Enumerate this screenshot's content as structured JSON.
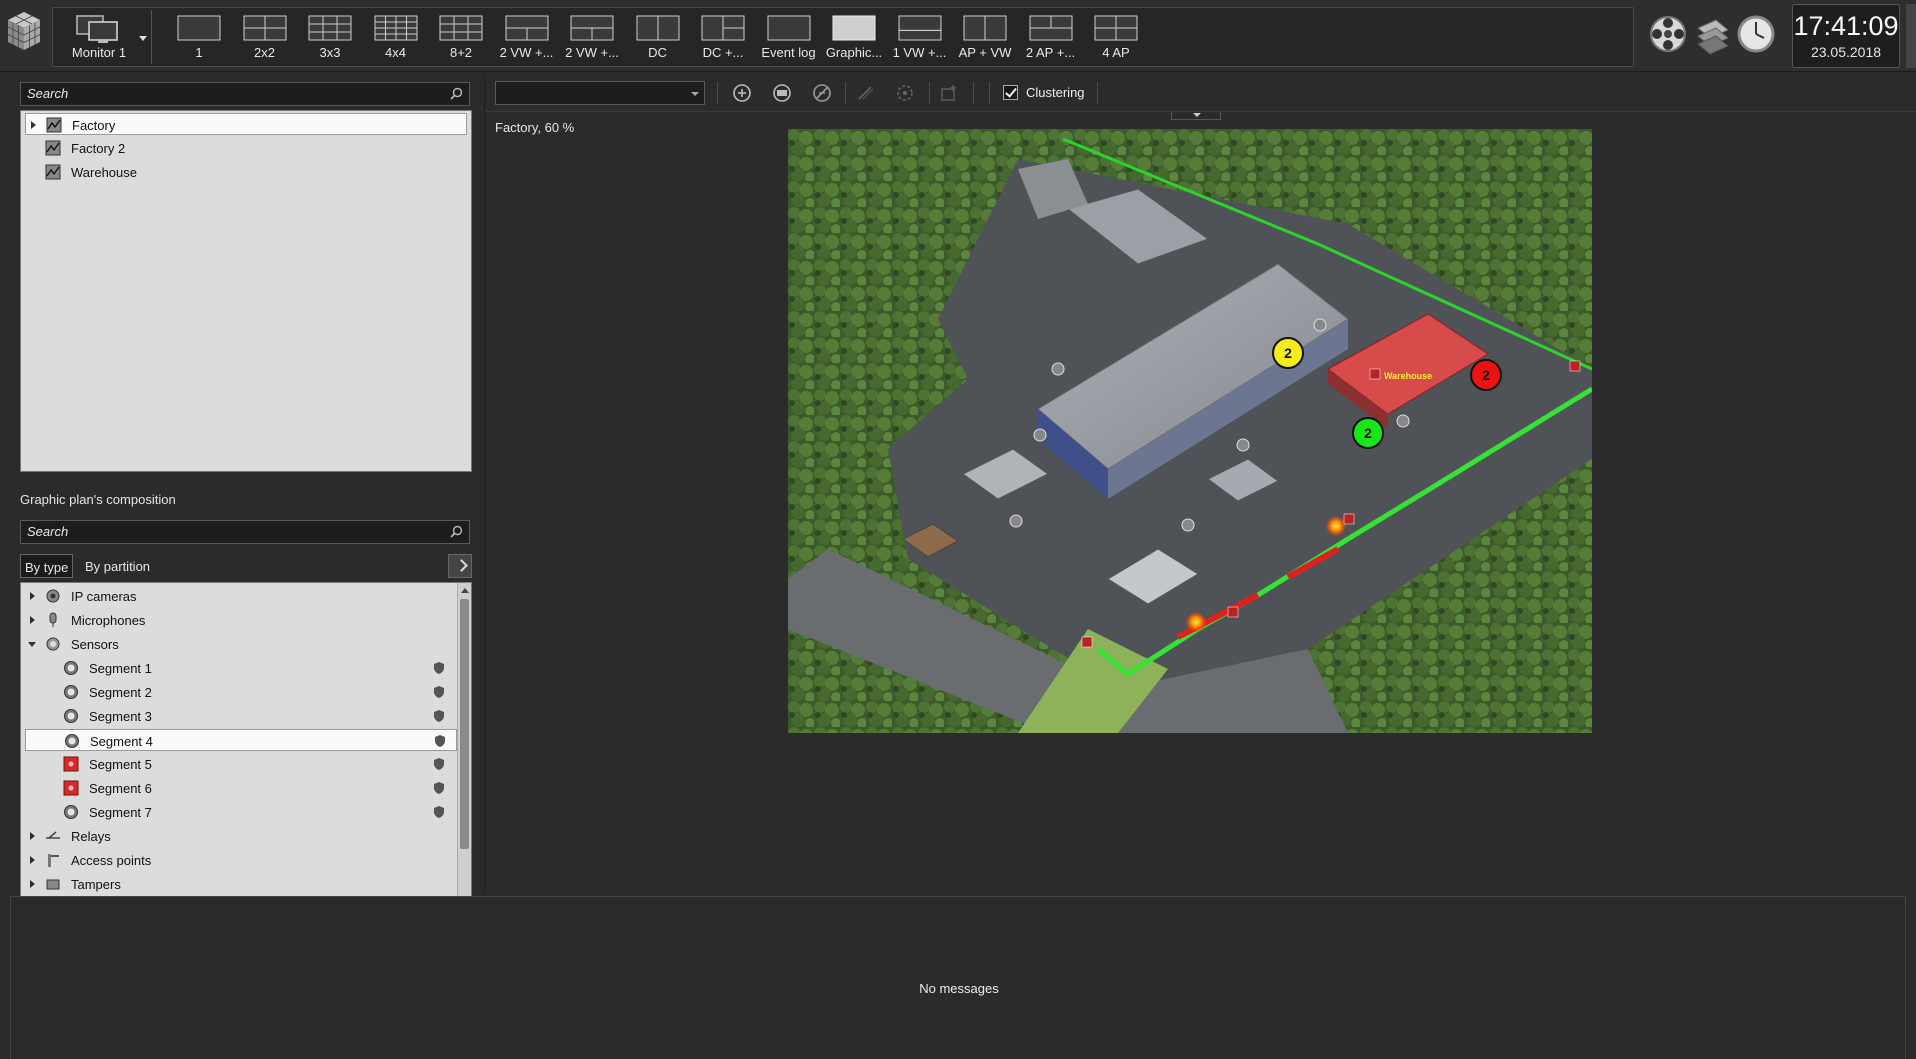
{
  "monitor": {
    "label": "Monitor 1"
  },
  "layouts": [
    {
      "label": "1",
      "icon": "layout-1-icon"
    },
    {
      "label": "2x2",
      "icon": "layout-2x2-icon"
    },
    {
      "label": "3x3",
      "icon": "layout-3x3-icon"
    },
    {
      "label": "4x4",
      "icon": "layout-4x4-icon"
    },
    {
      "label": "8+2",
      "icon": "layout-8plus2-icon"
    },
    {
      "label": "2 VW +...",
      "icon": "layout-2vw-icon"
    },
    {
      "label": "2 VW +...",
      "icon": "layout-2vw-icon"
    },
    {
      "label": "DC",
      "icon": "layout-dc-icon"
    },
    {
      "label": "DC +...",
      "icon": "layout-dc-plus-icon"
    },
    {
      "label": "Event log",
      "icon": "layout-eventlog-icon"
    },
    {
      "label": "Graphic...",
      "icon": "layout-graphic-icon"
    },
    {
      "label": "1 VW +...",
      "icon": "layout-1vw-icon"
    },
    {
      "label": "AP + VW",
      "icon": "layout-ap-vw-icon"
    },
    {
      "label": "2 AP +...",
      "icon": "layout-2ap-icon"
    },
    {
      "label": "4 AP",
      "icon": "layout-4ap-icon"
    }
  ],
  "clock": {
    "time": "17:41:09",
    "date": "23.05.2018"
  },
  "plans_search": {
    "placeholder": "Search"
  },
  "plans": [
    {
      "label": "Factory",
      "selected": true
    },
    {
      "label": "Factory 2",
      "selected": false
    },
    {
      "label": "Warehouse",
      "selected": false
    }
  ],
  "composition": {
    "title": "Graphic plan's composition",
    "search_placeholder": "Search",
    "tabs": [
      "By type",
      "By partition"
    ],
    "items": [
      {
        "label": "IP cameras",
        "level": 0,
        "expand": "collapsed",
        "icon": "ip-camera-icon"
      },
      {
        "label": "Microphones",
        "level": 0,
        "expand": "collapsed",
        "icon": "microphone-icon"
      },
      {
        "label": "Sensors",
        "level": 0,
        "expand": "expanded",
        "icon": "sensor-icon"
      },
      {
        "label": "Segment 1",
        "level": 1,
        "status": "normal"
      },
      {
        "label": "Segment 2",
        "level": 1,
        "status": "normal"
      },
      {
        "label": "Segment 3",
        "level": 1,
        "status": "normal"
      },
      {
        "label": "Segment 4",
        "level": 1,
        "status": "normal",
        "selected": true
      },
      {
        "label": "Segment 5",
        "level": 1,
        "status": "alarm"
      },
      {
        "label": "Segment 6",
        "level": 1,
        "status": "alarm"
      },
      {
        "label": "Segment 7",
        "level": 1,
        "status": "normal"
      },
      {
        "label": "Relays",
        "level": 0,
        "expand": "collapsed",
        "icon": "relay-icon"
      },
      {
        "label": "Access points",
        "level": 0,
        "expand": "collapsed",
        "icon": "access-point-icon"
      },
      {
        "label": "Tampers",
        "level": 0,
        "expand": "collapsed",
        "icon": "tamper-icon"
      }
    ]
  },
  "plan_toolbar": {
    "clustering_label": "Clustering",
    "clustering_checked": true,
    "combo_value": ""
  },
  "plan_view": {
    "caption": "Factory, 60 %",
    "building_label": "Warehouse",
    "clusters": [
      {
        "count": "2",
        "color": "#f5ec1a"
      },
      {
        "count": "2",
        "color": "#ee1111"
      },
      {
        "count": "2",
        "color": "#19e619"
      }
    ]
  },
  "messages": {
    "text": "No messages"
  },
  "colors": {
    "alarm": "#d42a2a",
    "ok": "#22dd22",
    "warn": "#f5ec1a"
  }
}
